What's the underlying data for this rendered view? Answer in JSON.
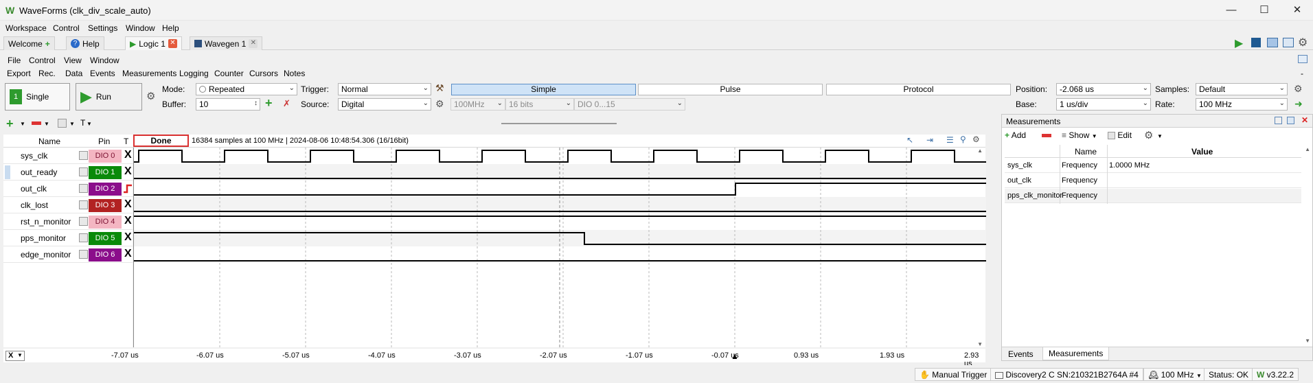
{
  "window": {
    "title": "WaveForms (clk_div_scale_auto)"
  },
  "main_menu": [
    "Workspace",
    "Control",
    "Settings",
    "Window",
    "Help"
  ],
  "doc_tabs": [
    {
      "label": "Welcome"
    },
    {
      "label": "Help"
    },
    {
      "label": "Logic 1"
    },
    {
      "label": "Wavegen 1"
    }
  ],
  "sub_menu": [
    "File",
    "Control",
    "View",
    "Window"
  ],
  "inst_menu": [
    "Export",
    "Rec.",
    "Data",
    "Events",
    "Measurements",
    "Logging",
    "Counter",
    "Cursors",
    "Notes"
  ],
  "controls": {
    "single_label": "Single",
    "run_label": "Run",
    "mode_label": "Mode:",
    "mode_value": "Repeated",
    "buffer_label": "Buffer:",
    "buffer_value": "10",
    "trigger_label": "Trigger:",
    "trigger_value": "Normal",
    "source_label": "Source:",
    "source_value": "Digital",
    "mode_buttons": [
      "Simple",
      "Pulse",
      "Protocol"
    ],
    "rate_sel": "100MHz",
    "bits_sel": "16 bits",
    "dio_sel": "DIO 0...15",
    "position_label": "Position:",
    "position_value": "-2.068 us",
    "base_label": "Base:",
    "base_value": "1 us/div",
    "samples_label": "Samples:",
    "samples_value": "Default",
    "rate_label": "Rate:",
    "rate_value": "100 MHz"
  },
  "header": {
    "name_col": "Name",
    "pin_col": "Pin",
    "t_col": "T",
    "status": "Done",
    "info": "16384 samples at 100 MHz | 2024-08-06 10:48:54.306 (16/16bit)"
  },
  "channels": [
    {
      "name": "sys_clk",
      "pin": "DIO 0",
      "color": "#f4b6c2",
      "text_color": "#7a1030",
      "trigger": "X"
    },
    {
      "name": "out_ready",
      "pin": "DIO 1",
      "color": "#0a8a0a",
      "text_color": "#ffffff",
      "trigger": "X"
    },
    {
      "name": "out_clk",
      "pin": "DIO 2",
      "color": "#8b0d8b",
      "text_color": "#ffffff",
      "trigger": "rise"
    },
    {
      "name": "clk_lost",
      "pin": "DIO 3",
      "color": "#b22222",
      "text_color": "#ffffff",
      "trigger": "X"
    },
    {
      "name": "rst_n_monitor",
      "pin": "DIO 4",
      "color": "#f4b6c2",
      "text_color": "#7a1030",
      "trigger": "X"
    },
    {
      "name": "pps_monitor",
      "pin": "DIO 5",
      "color": "#0a8a0a",
      "text_color": "#ffffff",
      "trigger": "X"
    },
    {
      "name": "edge_monitor",
      "pin": "DIO 6",
      "color": "#8b0d8b",
      "text_color": "#ffffff",
      "trigger": "X"
    }
  ],
  "axis_ticks": [
    "-7.07 us",
    "-6.07 us",
    "-5.07 us",
    "-4.07 us",
    "-3.07 us",
    "-2.07 us",
    "-1.07 us",
    "-0.07 us",
    "0.93 us",
    "1.93 us",
    "2.93 us"
  ],
  "axis_unit": "X",
  "measurements": {
    "panel_title": "Measurements",
    "add_label": "Add",
    "show_label": "Show",
    "edit_label": "Edit",
    "col_name": "Name",
    "col_value": "Value",
    "rows": [
      {
        "channel": "sys_clk",
        "name": "Frequency",
        "value": "1.0000 MHz"
      },
      {
        "channel": "out_clk",
        "name": "Frequency",
        "value": ""
      },
      {
        "channel": "pps_clk_monitor",
        "name": "Frequency",
        "value": ""
      }
    ],
    "tabs": [
      "Events",
      "Measurements"
    ]
  },
  "status_bar": {
    "manual_trigger": "Manual Trigger",
    "device": "Discovery2 C SN:210321B2764A #4",
    "clock": "100 MHz",
    "status": "Status: OK",
    "version": "v3.22.2"
  }
}
